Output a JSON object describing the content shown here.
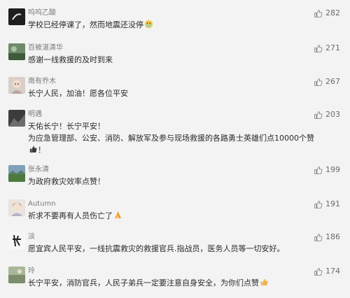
{
  "comments": [
    {
      "name": "呜呜乙酸",
      "text": [
        "学校已经停课了，然而地震还没停"
      ],
      "emoji": "mask-face-emoji",
      "likes": "282"
    },
    {
      "name": "百被湛清华",
      "text": [
        "感谢一线救援的及时到来"
      ],
      "emoji": "",
      "likes": "271"
    },
    {
      "name": "南有乔木",
      "text": [
        "长宁人民，加油！愿各位平安"
      ],
      "emoji": "",
      "likes": "267"
    },
    {
      "name": "明遇",
      "text": [
        "天佑长宁！长宁平安！",
        "为应急管理部、公安、消防、解放军及参与现场救援的各路勇士英雄们点10000个赞",
        "！"
      ],
      "emoji": "thumbs-up-emoji",
      "likes": "203"
    },
    {
      "name": "张永清",
      "text": [
        "为政府救灾效率点赞！"
      ],
      "emoji": "",
      "likes": "199"
    },
    {
      "name": "Autumn",
      "text": [
        "祈求不要再有人员伤亡了"
      ],
      "emoji": "praying-hands-emoji",
      "likes": "191"
    },
    {
      "name": "淡",
      "text": [
        "愿宜宾人民平安，一线抗震救灾的救援官兵.指战员，医务人员等一切安好。"
      ],
      "emoji": "",
      "likes": "186"
    },
    {
      "name": "玲",
      "text": [
        "长宁平安，消防官兵，人民子弟兵一定要注意自身安全，为你们点赞"
      ],
      "emoji": "thumbs-up-emoji",
      "likes": "174"
    }
  ],
  "colors": {
    "background": "#f3f3f3",
    "name": "#7a7a7a",
    "text": "#2a2a2a",
    "likes": "#6b6b6b"
  }
}
